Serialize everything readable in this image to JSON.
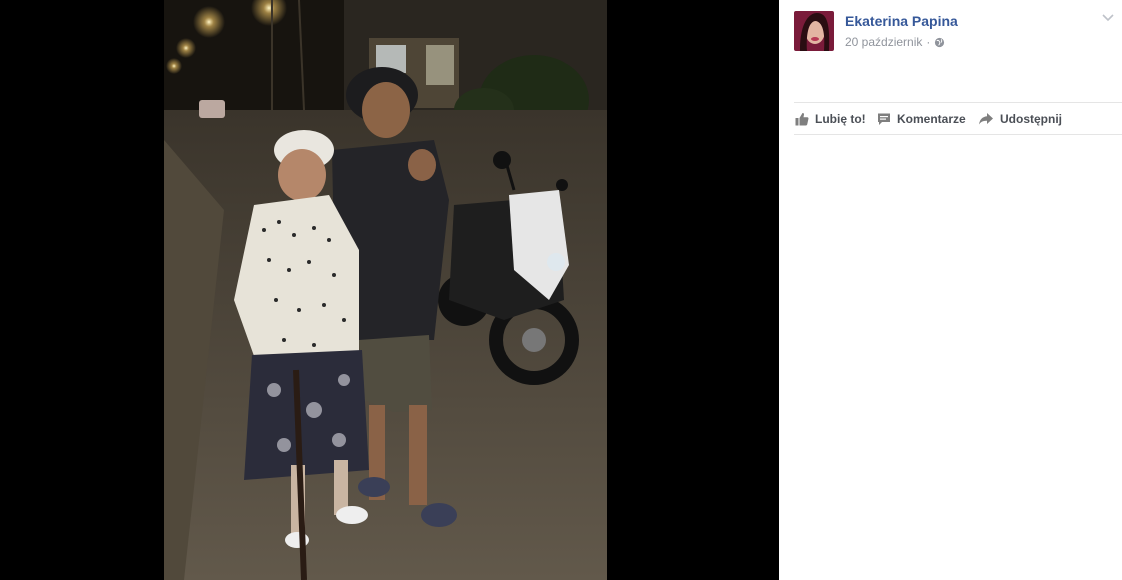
{
  "post": {
    "author": "Ekaterina Papina",
    "date": "20 październik",
    "separator": "·",
    "privacy_icon": "globe-icon",
    "options_icon": "chevron-down-icon"
  },
  "actions": {
    "like": {
      "label": "Lubię to!",
      "icon": "thumbs-up-icon"
    },
    "comment": {
      "label": "Komentarze",
      "icon": "comment-icon"
    },
    "share": {
      "label": "Udostępnij",
      "icon": "share-icon"
    }
  },
  "colors": {
    "author_link": "#365899",
    "meta_text": "#90949c",
    "action_text": "#4b4f56",
    "divider": "#e5e5e5",
    "stage_bg": "#000000"
  }
}
